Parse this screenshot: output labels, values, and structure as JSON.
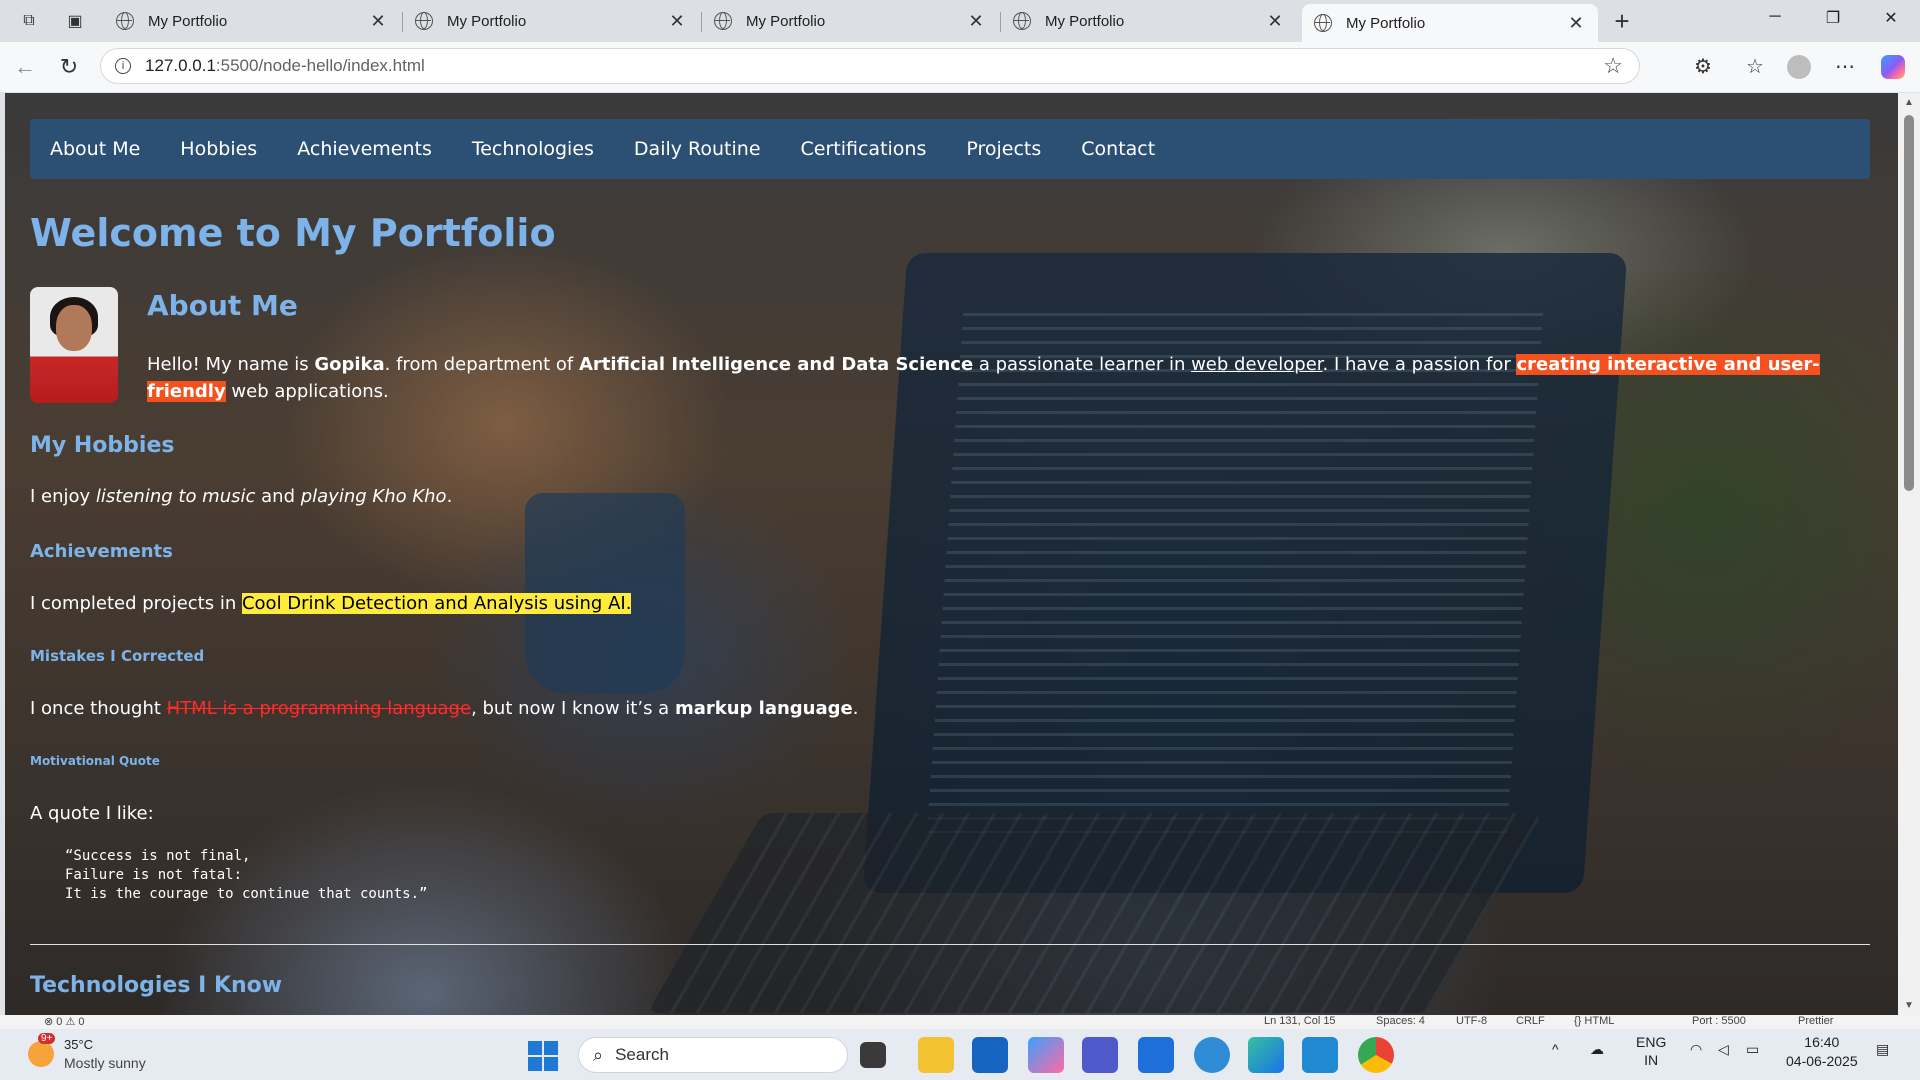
{
  "browser": {
    "tabs": [
      {
        "title": "My Portfolio",
        "active": false
      },
      {
        "title": "My Portfolio",
        "active": false
      },
      {
        "title": "My Portfolio",
        "active": false
      },
      {
        "title": "My Portfolio",
        "active": false
      },
      {
        "title": "My Portfolio",
        "active": true
      }
    ],
    "url_host": "127.0.0.1",
    "url_rest": ":5500/node-hello/index.html"
  },
  "page": {
    "nav": [
      "About Me",
      "Hobbies",
      "Achievements",
      "Technologies",
      "Daily Routine",
      "Certifications",
      "Projects",
      "Contact"
    ],
    "title": "Welcome to My Portfolio",
    "about_heading": "About Me",
    "about": {
      "t1": "Hello! My name is ",
      "name": "Gopika",
      "t2": ". from department of ",
      "dept": "Artificial Intelligence and Data Science",
      "t3": " a passionate learner in ",
      "link": "web developer",
      "t4": ". I have a passion for ",
      "highlight": "creating interactive and user-friendly",
      "t5": " web applications."
    },
    "hobbies_heading": "My Hobbies",
    "hobbies": {
      "t1": "I enjoy ",
      "h1": "listening to music",
      "t2": " and ",
      "h2": "playing Kho Kho",
      "t3": "."
    },
    "achievements_heading": "Achievements",
    "achievements": {
      "t1": "I completed projects in ",
      "highlight": "Cool Drink Detection and Analysis using AI."
    },
    "mistakes_heading": "Mistakes I Corrected",
    "mistakes": {
      "t1": "I once thought ",
      "wrong": "HTML is a programming language",
      "t2": ", but now I know it’s a ",
      "right": "markup language",
      "t3": "."
    },
    "quote_heading": "Motivational Quote",
    "quote_intro": "A quote I like:",
    "quote": "“Success is not final,\nFailure is not fatal:\nIt is the courage to continue that counts.”",
    "tech_heading": "Technologies I Know"
  },
  "statusbar": {
    "left": "⊗ 0 ⚠ 0",
    "position": "Ln 131, Col 15",
    "spaces": "Spaces: 4",
    "encoding": "UTF-8",
    "eol": "CRLF",
    "lang": "{} HTML",
    "port": "Port : 5500",
    "prettier": "Prettier"
  },
  "taskbar": {
    "weather_badge": "9+",
    "temperature": "35°C",
    "weather": "Mostly sunny",
    "search": "Search",
    "lang_top": "ENG",
    "lang_bottom": "IN",
    "time": "16:40",
    "date": "04-06-2025"
  },
  "colors": {
    "navbar": "#2c5073",
    "heading": "#7db3e8",
    "highlight_red": "#f4511e",
    "highlight_yellow": "#ffeb3b"
  }
}
